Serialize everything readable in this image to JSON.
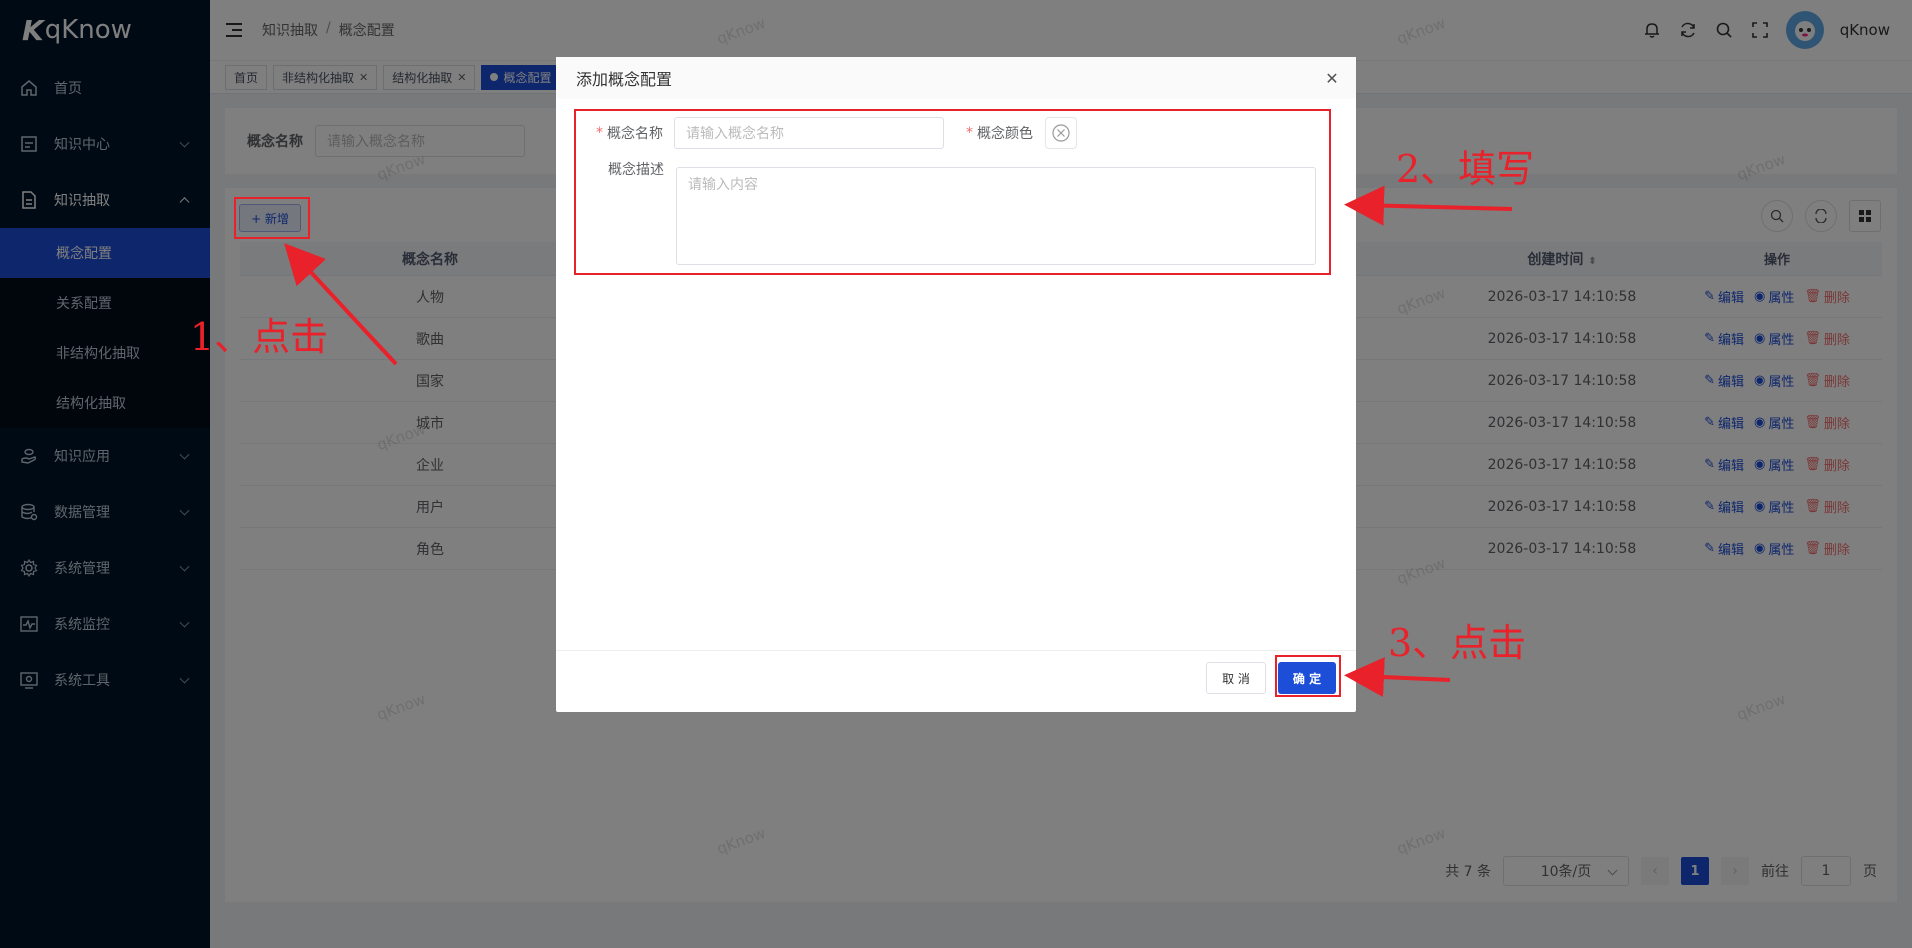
{
  "app": {
    "logo_mark": "K",
    "logo_text": "qKnow"
  },
  "sidebar": {
    "items": [
      {
        "label": "首页",
        "icon": "home-icon"
      },
      {
        "label": "知识中心",
        "icon": "monitor-icon"
      },
      {
        "label": "知识抽取",
        "icon": "document-icon",
        "open": true
      },
      {
        "label": "知识应用",
        "icon": "hand-icon"
      },
      {
        "label": "数据管理",
        "icon": "database-icon"
      },
      {
        "label": "系统管理",
        "icon": "gear-icon"
      },
      {
        "label": "系统监控",
        "icon": "pulse-icon"
      },
      {
        "label": "系统工具",
        "icon": "tools-icon"
      }
    ],
    "sub_items": [
      {
        "label": "概念配置",
        "active": true
      },
      {
        "label": "关系配置"
      },
      {
        "label": "非结构化抽取"
      },
      {
        "label": "结构化抽取"
      }
    ]
  },
  "header": {
    "breadcrumb": [
      "知识抽取",
      "/",
      "概念配置"
    ],
    "username": "qKnow"
  },
  "tags": [
    {
      "label": "首页"
    },
    {
      "label": "非结构化抽取",
      "closable": true
    },
    {
      "label": "结构化抽取",
      "closable": true
    },
    {
      "label": "概念配置",
      "active": true
    }
  ],
  "search": {
    "label": "概念名称",
    "placeholder": "请输入概念名称"
  },
  "toolbar": {
    "add_label": "+ 新增"
  },
  "table": {
    "headers": {
      "name": "概念名称",
      "time": "创建时间",
      "op": "操作"
    },
    "rows": [
      {
        "name": "人物",
        "time": "2026-03-17 14:10:58"
      },
      {
        "name": "歌曲",
        "time": "2026-03-17 14:10:58"
      },
      {
        "name": "国家",
        "time": "2026-03-17 14:10:58"
      },
      {
        "name": "城市",
        "time": "2026-03-17 14:10:58"
      },
      {
        "name": "企业",
        "time": "2026-03-17 14:10:58"
      },
      {
        "name": "用户",
        "time": "2026-03-17 14:10:58"
      },
      {
        "name": "角色",
        "time": "2026-03-17 14:10:58"
      }
    ],
    "ops": {
      "edit": "编辑",
      "attr": "属性",
      "delete": "删除"
    }
  },
  "pager": {
    "total": "共 7 条",
    "size": "10条/页",
    "page": "1",
    "goto_label": "前往",
    "goto_value": "1",
    "page_unit": "页"
  },
  "dialog": {
    "title": "添加概念配置",
    "name_label": "概念名称",
    "name_placeholder": "请输入概念名称",
    "color_label": "概念颜色",
    "desc_label": "概念描述",
    "desc_placeholder": "请输入内容",
    "cancel": "取 消",
    "ok": "确 定"
  },
  "annotations": {
    "step1": "1、点击",
    "step2": "2、填写",
    "step3": "3、点击"
  },
  "watermark": "qKnow",
  "colors": {
    "primary": "#1d4ed8",
    "sidebar": "#001529",
    "annotation": "#e8212a",
    "danger": "#f56c6c"
  }
}
